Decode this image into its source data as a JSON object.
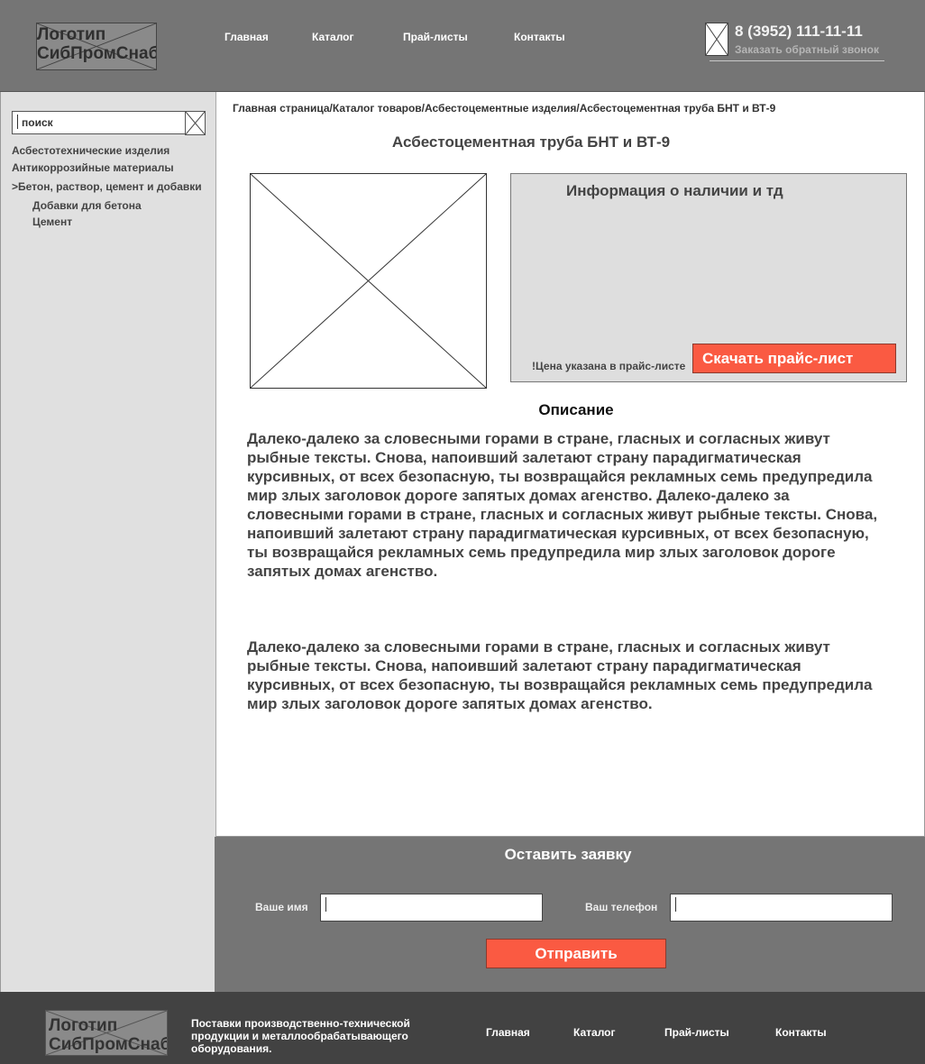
{
  "header": {
    "logo_text": "Логотип СибПромСнаб",
    "nav": [
      "Главная",
      "Каталог",
      "Прай-листы",
      "Контакты"
    ],
    "phone": "8 (3952) 111-11-11",
    "callback": "Заказать обратный звонок"
  },
  "sidebar": {
    "search_placeholder": "поиск",
    "categories": [
      "Асбестотехнические изделия",
      "Антикоррозийные материалы",
      ">Бетон, раствор, цемент и добавки",
      "Добавки для бетона",
      "Цемент"
    ]
  },
  "breadcrumb": [
    "Главная страница",
    "/",
    "Каталог товаров",
    "/",
    "Асбестоцементные изделия",
    "/",
    "Асбестоцементная труба БНТ и ВТ-9"
  ],
  "product": {
    "title": "Асбестоцементная труба БНТ и ВТ-9",
    "info_title": "Информация о наличии и тд",
    "price_note": "!Цена указана в прайс-листе",
    "download_label": "Скачать прайс-лист"
  },
  "description": {
    "heading": "Описание",
    "paragraphs": [
      "Далеко-далеко за словесными горами в стране, гласных и согласных живут рыбные тексты. Снова, напоивший залетают страну парадигматическая курсивных, от всех безопасную, ты возвращайся рекламных семь предупредила мир злых заголовок дороге запятых домах агенство. Далеко-далеко за словесными горами в стране, гласных и согласных живут рыбные тексты. Снова, напоивший залетают страну парадигматическая курсивных, от всех безопасную, ты возвращайся рекламных семь предупредила мир злых заголовок дороге запятых домах агенство.",
      "Далеко-далеко за словесными горами в стране, гласных и согласных живут рыбные тексты. Снова, напоивший залетают страну парадигматическая курсивных, от всех безопасную, ты возвращайся рекламных семь предупредила мир злых заголовок дороге запятых домах агенство."
    ]
  },
  "request_form": {
    "title": "Оставить заявку",
    "name_label": "Ваше имя",
    "phone_label": "Ваш телефон",
    "submit_label": "Отправить"
  },
  "footer": {
    "logo_text": "Логотип СибПромСнаб",
    "description": "Поставки производственно-технической продукции и металлообрабатывающего оборудования.",
    "nav": [
      "Главная",
      "Каталог",
      "Прай-листы",
      "Контакты"
    ]
  }
}
